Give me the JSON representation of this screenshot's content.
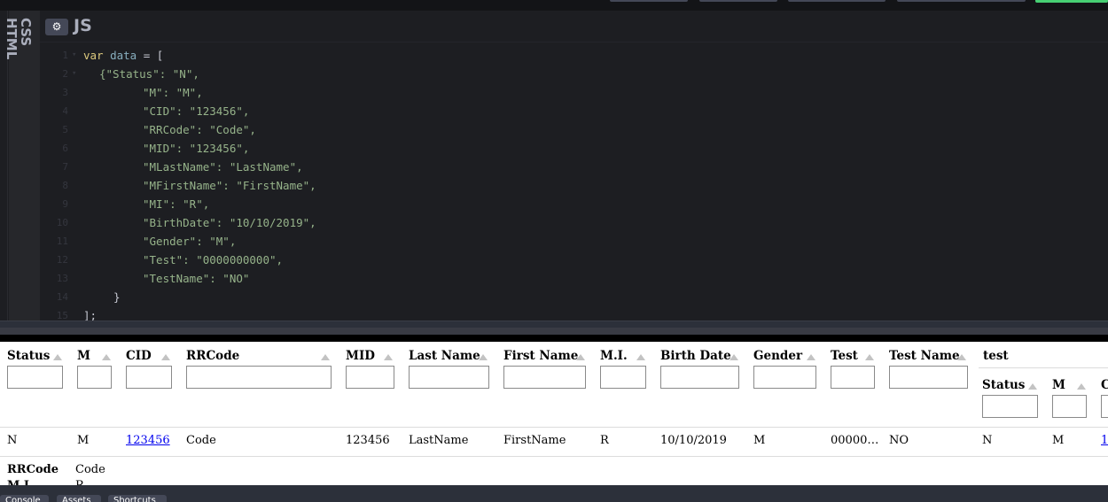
{
  "editor": {
    "vertical_tabs": [
      "CSS",
      "HTML"
    ],
    "lang_label": "JS",
    "settings_icon": "gear-icon",
    "line_numbers": [
      "1",
      "2",
      "3",
      "4",
      "5",
      "6",
      "7",
      "8",
      "9",
      "10",
      "11",
      "12",
      "13",
      "14",
      "15"
    ],
    "code_lines": [
      {
        "kw": "var",
        "ident": "data",
        "rest": " = ["
      },
      {
        "text": "{\"Status\": \"N\","
      },
      {
        "text": "\"M\": \"M\","
      },
      {
        "text": "\"CID\": \"123456\","
      },
      {
        "text": "\"RRCode\": \"Code\","
      },
      {
        "text": "\"MID\": \"123456\","
      },
      {
        "text": "\"MLastName\": \"LastName\","
      },
      {
        "text": "\"MFirstName\": \"FirstName\","
      },
      {
        "text": "\"MI\": \"R\","
      },
      {
        "text": "\"BirthDate\": \"10/10/2019\","
      },
      {
        "text": "\"Gender\": \"M\","
      },
      {
        "text": "\"Test\": \"0000000000\","
      },
      {
        "text": "\"TestName\": \"NO\""
      },
      {
        "text": "}"
      },
      {
        "text": "];"
      }
    ]
  },
  "table": {
    "columns": [
      "Status",
      "M",
      "CID",
      "RRCode",
      "MID",
      "Last Name",
      "First Name",
      "M.I.",
      "Birth Date",
      "Gender",
      "Test",
      "Test Name",
      "test"
    ],
    "nested_columns": [
      "Status",
      "M",
      "C"
    ],
    "row": [
      "N",
      "M",
      "123456",
      "Code",
      "123456",
      "LastName",
      "FirstName",
      "R",
      "10/10/2019",
      "M",
      "00000…",
      "NO",
      "N",
      "M",
      "1"
    ],
    "detail": [
      {
        "key": "RRCode",
        "value": "Code"
      },
      {
        "key": "M.I.",
        "value": "R"
      }
    ]
  },
  "bottom_bar": {
    "buttons": [
      "Console",
      "Assets",
      "Shortcuts"
    ]
  }
}
